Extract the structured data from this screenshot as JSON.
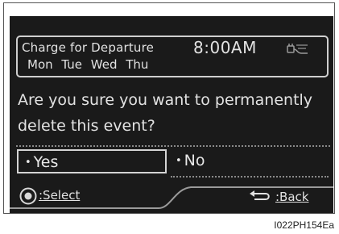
{
  "event": {
    "title": "Charge for Departure",
    "time": "8:00AM",
    "days": "Mon Tue Wed Thu",
    "icon": "charging-plug-icon"
  },
  "dialog": {
    "question": "Are you sure you want to permanently delete this event?",
    "yes_label": "Yes",
    "no_label": "No",
    "selected": "Yes"
  },
  "footer": {
    "select_label": ":Select",
    "select_icon": "dial-knob-icon",
    "back_label": ":Back",
    "back_icon": "return-arrow-icon"
  },
  "caption": {
    "image_code": "I022PH154Ea"
  },
  "colors": {
    "screen_bg": "#1a1a1a",
    "text": "#e2e2e2",
    "border": "#cfcfcf"
  }
}
